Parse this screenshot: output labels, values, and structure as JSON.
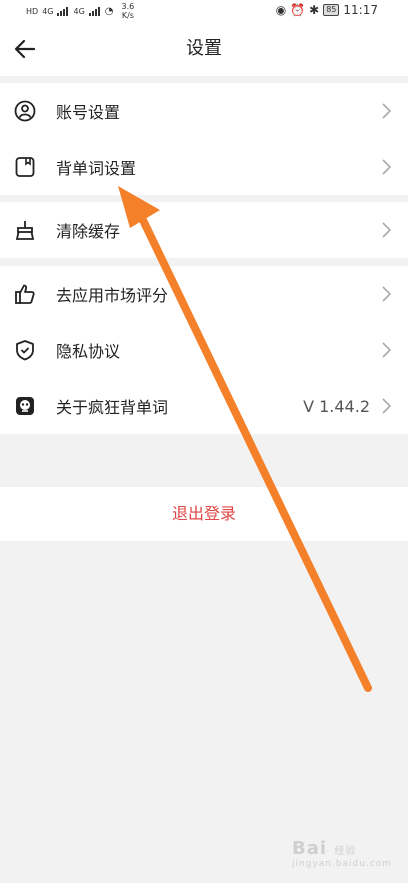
{
  "status": {
    "net_speed_top": "3.6",
    "net_speed_unit": "K/s",
    "battery": "85",
    "time": "11:17",
    "sig1": "4G",
    "sig2": "4G",
    "hd": "HD"
  },
  "header": {
    "title": "设置"
  },
  "groups": [
    {
      "items": [
        {
          "label": "账号设置"
        },
        {
          "label": "背单词设置"
        }
      ]
    },
    {
      "items": [
        {
          "label": "清除缓存"
        }
      ]
    },
    {
      "items": [
        {
          "label": "去应用市场评分"
        },
        {
          "label": "隐私协议"
        },
        {
          "label": "关于疯狂背单词",
          "value": "V 1.44.2"
        }
      ]
    }
  ],
  "logout": {
    "label": "退出登录",
    "color": "#e04646"
  },
  "annotation": {
    "arrow_color": "#f5802a"
  },
  "watermark": {
    "brand": "Bai",
    "sub": "经验",
    "site": "jingyan.baidu.com"
  }
}
